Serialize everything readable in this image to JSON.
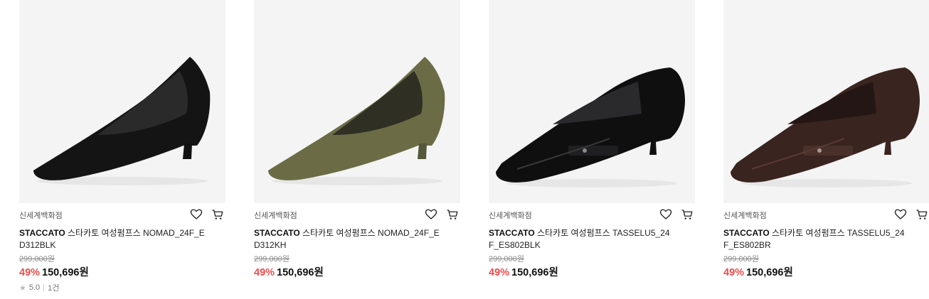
{
  "products": [
    {
      "store": "신세계백화점",
      "brand": "STACCATO",
      "name": " 스타카토 여성펌프스 NOMAD_24F_E D312BLK",
      "original_price": "299,000원",
      "discount": "49%",
      "price": "150,696원",
      "rating": "5.0",
      "reviews": "1건",
      "color": "#141414"
    },
    {
      "store": "신세계백화점",
      "brand": "STACCATO",
      "name": " 스타카토 여성펌프스 NOMAD_24F_E D312KH",
      "original_price": "299,000원",
      "discount": "49%",
      "price": "150,696원",
      "color": "#6b6c45"
    },
    {
      "store": "신세계백화점",
      "brand": "STACCATO",
      "name": " 스타카토 여성펌프스 TASSELU5_24 F_ES802BLK",
      "original_price": "299,000원",
      "discount": "49%",
      "price": "150,696원",
      "color": "#0f0f10"
    },
    {
      "store": "신세계백화점",
      "brand": "STACCATO",
      "name": " 스타카토 여성펌프스 TASSELU5_24 F_ES802BR",
      "original_price": "299,000원",
      "discount": "49%",
      "price": "150,696원",
      "color": "#3a2420"
    }
  ],
  "icons": {
    "wishlist": "heart-icon",
    "cart": "cart-icon",
    "rating": "star-icon"
  }
}
